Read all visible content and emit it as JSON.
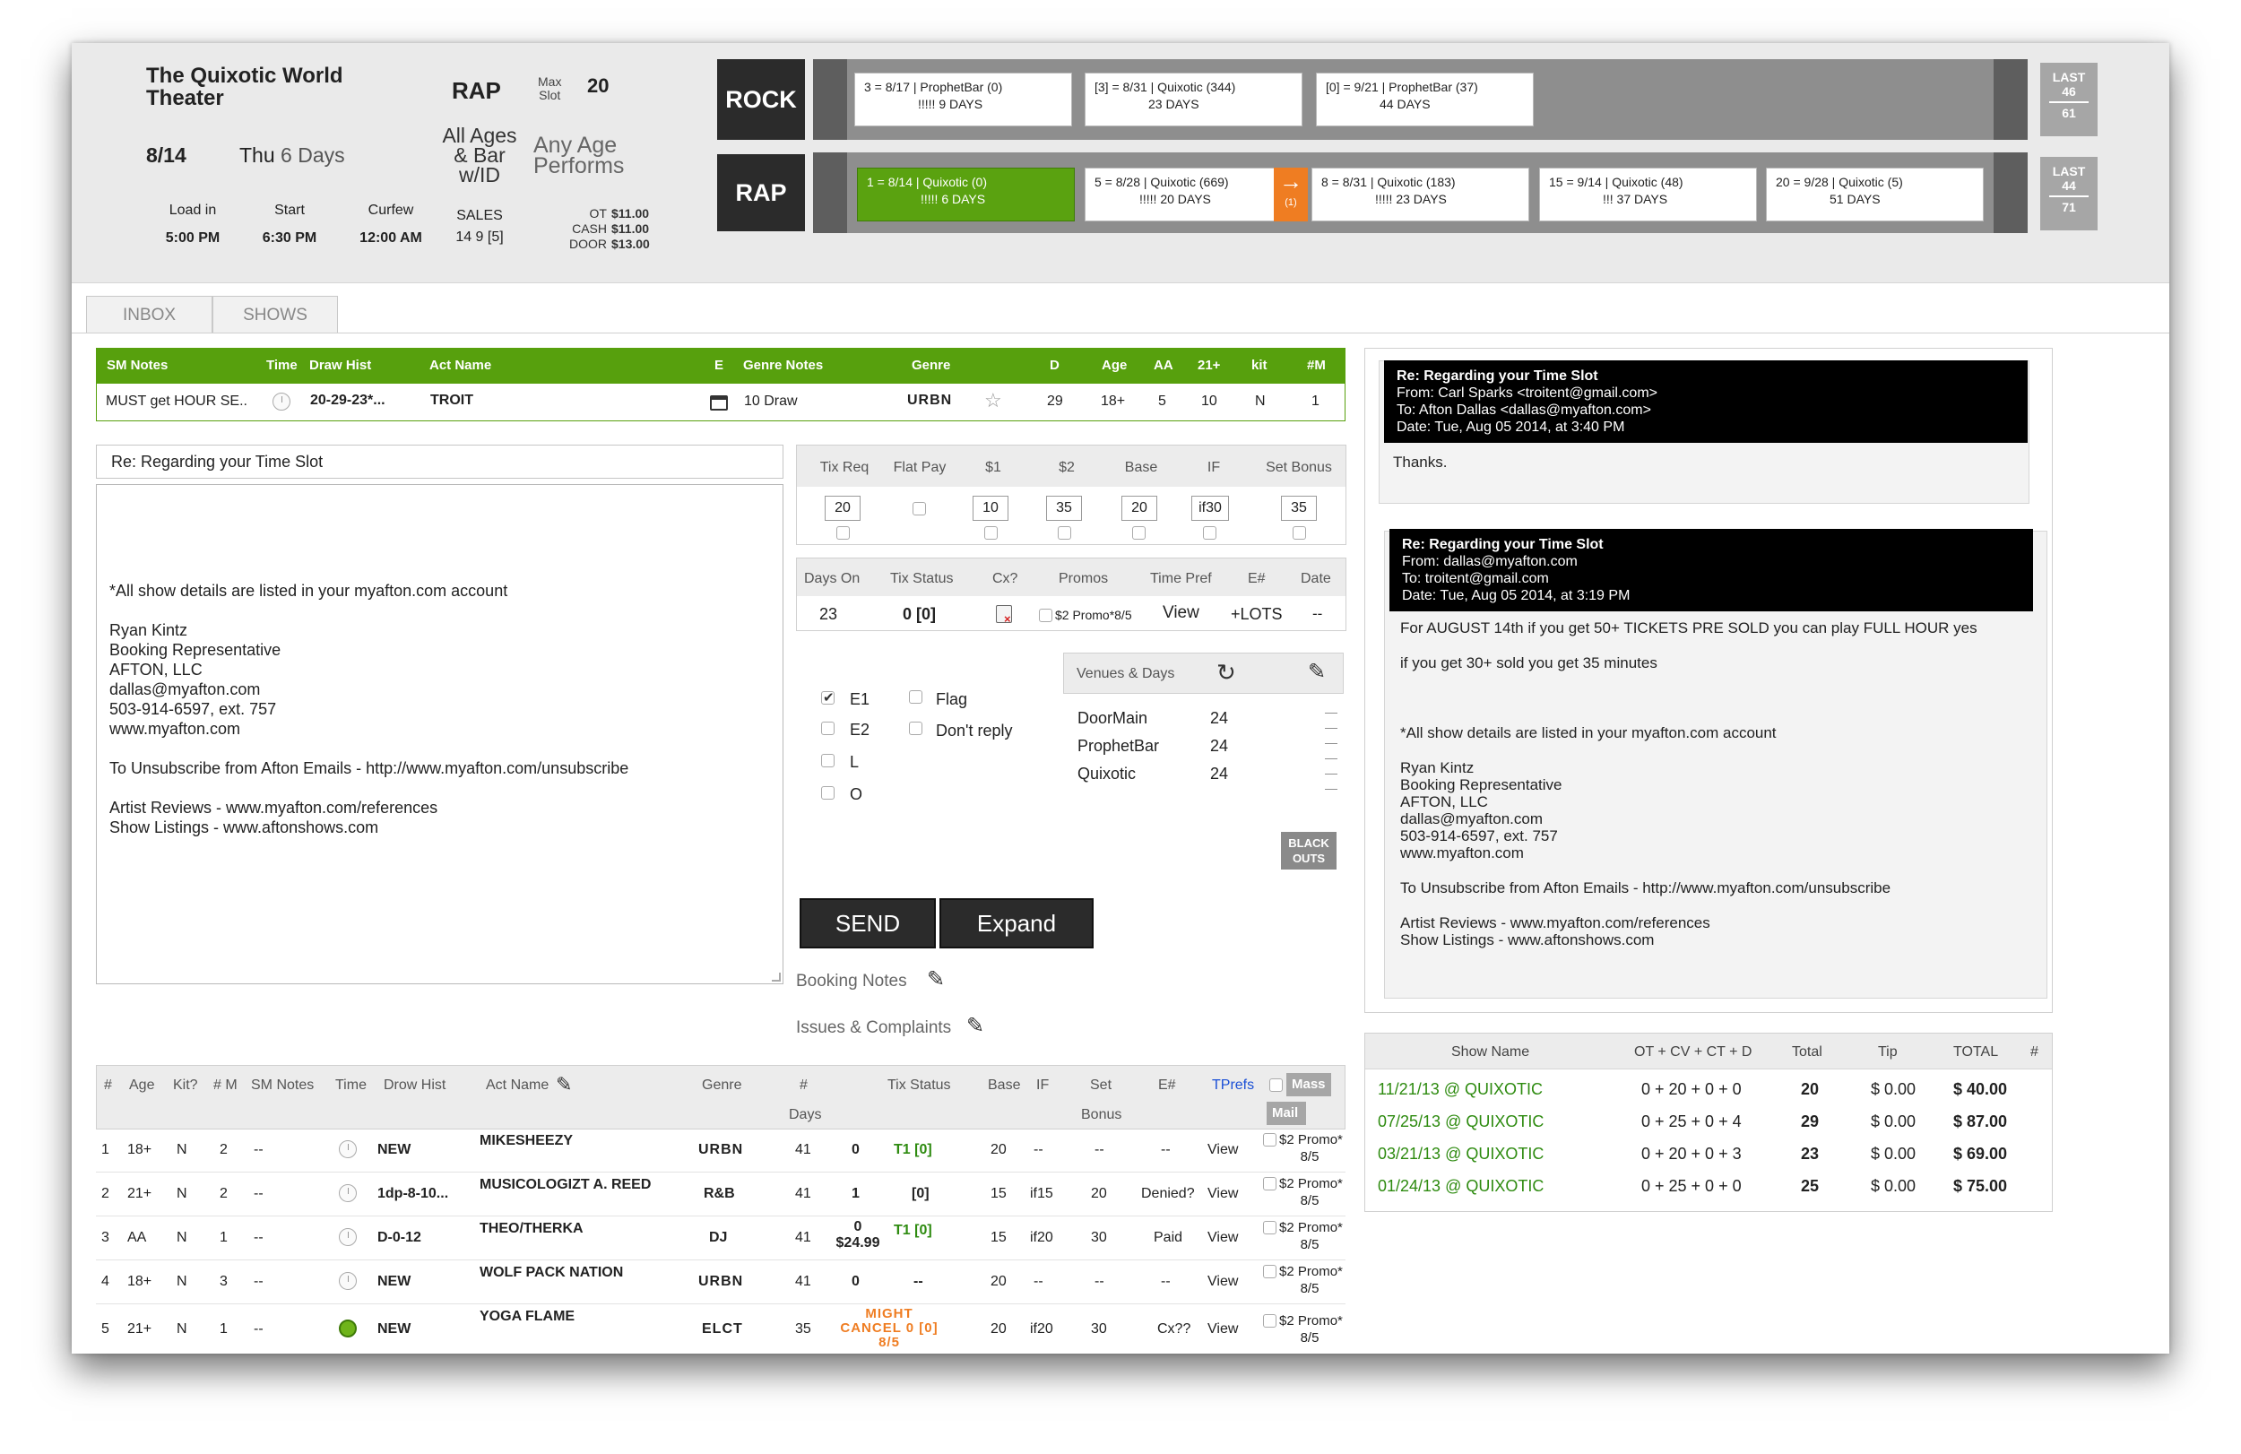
{
  "venue": {
    "name_line1": "The Quixotic World",
    "name_line2": "Theater",
    "date": "8/14",
    "day": "Thu",
    "days_until": "6 Days",
    "genre": "RAP",
    "max_slot_label1": "Max",
    "max_slot_label2": "Slot",
    "max_slot_value": "20",
    "ages_line1": "All Ages",
    "ages_line2": "& Bar",
    "ages_line3": "w/ID",
    "performs_line1": "Any Age",
    "performs_line2": "Performs",
    "load_in_label": "Load in",
    "load_in": "5:00 PM",
    "start_label": "Start",
    "start": "6:30 PM",
    "curfew_label": "Curfew",
    "curfew": "12:00 AM",
    "sales_label": "SALES",
    "sales_value": "14 9 [5]",
    "ot_label": "OT",
    "ot_price": "$11.00",
    "cash_label": "CASH",
    "cash_price": "$11.00",
    "door_label": "DOOR",
    "door_price": "$13.00"
  },
  "timeline": {
    "rock": {
      "label": "ROCK",
      "cards": [
        {
          "line1": "3  =  8/17  |  ProphetBar (0)",
          "line2": "!!!!!  9 DAYS"
        },
        {
          "line1": "[3]  =  8/31  |  Quixotic (344)",
          "line2": "23 DAYS"
        },
        {
          "line1": "[0]  =  9/21  |  ProphetBar (37)",
          "line2": "44 DAYS"
        }
      ],
      "last_label": "LAST",
      "last_top": "46",
      "last_bottom": "61"
    },
    "rap": {
      "label": "RAP",
      "cards": [
        {
          "line1": "1  =  8/14  |  Quixotic (0)",
          "line2": "!!!!!  6 DAYS"
        },
        {
          "line1": "5  =  8/28  |  Quixotic (669)",
          "line2": "!!!!!  20 DAYS"
        },
        {
          "line1": "8  =  8/31  |  Quixotic (183)",
          "line2": "!!!!!  23 DAYS"
        },
        {
          "line1": "15  =  9/14  |  Quixotic (48)",
          "line2": "!!!  37 DAYS"
        },
        {
          "line1": "20  =  9/28  |  Quixotic (5)",
          "line2": "51 DAYS"
        }
      ],
      "arrow_count": "(1)",
      "last_label": "LAST",
      "last_top": "44",
      "last_bottom": "71"
    }
  },
  "tabs": {
    "inbox": "INBOX",
    "shows": "SHOWS"
  },
  "act_table": {
    "headers": [
      "SM Notes",
      "Time",
      "Draw Hist",
      "Act Name",
      "E",
      "Genre Notes",
      "Genre",
      "D",
      "Age",
      "AA",
      "21+",
      "kit",
      "#M"
    ],
    "row": {
      "sm_notes": "MUST get HOUR SE..",
      "draw_hist": "20-29-23*...",
      "act_name": "TROIT",
      "genre_notes": "10 Draw",
      "genre": "URBN",
      "d": "29",
      "age": "18+",
      "aa": "5",
      "plus21": "10",
      "kit": "N",
      "m": "1"
    }
  },
  "compose": {
    "subject": "Re: Regarding your Time Slot",
    "body_lines": [
      "*All show details are listed in your myafton.com account",
      "",
      "Ryan Kintz",
      "Booking Representative",
      "AFTON, LLC",
      "dallas@myafton.com",
      "503-914-6597, ext. 757",
      "www.myafton.com",
      "",
      "To Unsubscribe from Afton Emails - http://www.myafton.com/unsubscribe",
      "",
      "Artist Reviews - www.myafton.com/references",
      "Show Listings - www.aftonshows.com"
    ]
  },
  "pricing": {
    "headers": [
      "Tix Req",
      "Flat Pay",
      "$1",
      "$2",
      "Base",
      "IF",
      "Set Bonus"
    ],
    "tix_req": "20",
    "p1": "10",
    "p2": "35",
    "base": "20",
    "if_val": "if30",
    "set_bonus": "35"
  },
  "status": {
    "headers": [
      "Days On",
      "Tix Status",
      "Cx?",
      "Promos",
      "Time Pref",
      "E#",
      "Date"
    ],
    "days_on": "23",
    "tix_status": "0 [0]",
    "promo": "$2 Promo*8/5",
    "time_pref": "View",
    "e_num": "+LOTS",
    "date": "--"
  },
  "flags": {
    "e1": "E1",
    "e2": "E2",
    "l": "L",
    "o": "O",
    "flag": "Flag",
    "dont_reply": "Don't reply"
  },
  "venues_days": {
    "title": "Venues & Days",
    "items": [
      {
        "name": "DoorMain",
        "days": "24"
      },
      {
        "name": "ProphetBar",
        "days": "24"
      },
      {
        "name": "Quixotic",
        "days": "24"
      }
    ],
    "blackouts_line1": "BLACK",
    "blackouts_line2": "OUTS"
  },
  "actions": {
    "send": "SEND",
    "expand": "Expand",
    "booking_notes": "Booking Notes",
    "issues": "Issues & Complaints"
  },
  "shows_table": {
    "headers": {
      "num": "#",
      "age": "Age",
      "kit": "Kit?",
      "m": "# M",
      "sm_notes": "SM Notes",
      "time": "Time",
      "draw_hist": "Drow Hist",
      "act_name": "Act Name",
      "genre": "Genre",
      "days_num": "#",
      "days": "Days",
      "tix_status": "Tix Status",
      "base": "Base",
      "if_col": "IF",
      "set": "Set",
      "bonus": "Bonus",
      "e_num": "E#",
      "tprefs": "TPrefs",
      "mass": "Mass",
      "mail": "Mail"
    },
    "rows": [
      {
        "num": "1",
        "age": "18+",
        "kit": "N",
        "m": "2",
        "sm": "--",
        "draw": "NEW",
        "act": "MIKESHEEZY",
        "genre": "URBN",
        "days": "41",
        "tix": "0",
        "t1": "T1 [0]",
        "base": "20",
        "ifv": "--",
        "set": "--",
        "e": "--",
        "tpref": "View",
        "promo1": "$2 Promo*",
        "promo2": "8/5"
      },
      {
        "num": "2",
        "age": "21+",
        "kit": "N",
        "m": "2",
        "sm": "--",
        "draw": "1dp-8-10...",
        "act": "MUSICOLOGIZT A. REED",
        "genre": "R&B",
        "days": "41",
        "tix": "1",
        "t1": "[0]",
        "base": "15",
        "ifv": "if15",
        "set": "20",
        "e": "Denied?",
        "tpref": "View",
        "promo1": "$2 Promo*",
        "promo2": "8/5"
      },
      {
        "num": "3",
        "age": "AA",
        "kit": "N",
        "m": "1",
        "sm": "--",
        "draw": "D-0-12",
        "act": "THEO/THERKA",
        "genre": "DJ",
        "days": "41",
        "tix": "0",
        "tix2": "$24.99",
        "t1": "T1 [0]",
        "base": "15",
        "ifv": "if20",
        "set": "30",
        "e": "Paid",
        "tpref": "View",
        "promo1": "$2 Promo*",
        "promo2": "8/5"
      },
      {
        "num": "4",
        "age": "18+",
        "kit": "N",
        "m": "3",
        "sm": "--",
        "draw": "NEW",
        "act": "WOLF PACK NATION",
        "genre": "URBN",
        "days": "41",
        "tix": "0",
        "t1": "--",
        "base": "20",
        "ifv": "--",
        "set": "--",
        "e": "--",
        "tpref": "View",
        "promo1": "$2 Promo*",
        "promo2": "8/5"
      },
      {
        "num": "5",
        "age": "21+",
        "kit": "N",
        "m": "1",
        "sm": "--",
        "draw": "NEW",
        "act": "YOGA FLAME",
        "genre": "ELCT",
        "days": "35",
        "tix": "MIGHT",
        "tix2": "CANCEL 0 [0]",
        "tix3": "8/5",
        "base": "20",
        "ifv": "if20",
        "set": "30",
        "e": "Cx??",
        "tpref": "View",
        "promo1": "$2 Promo*",
        "promo2": "8/5"
      }
    ]
  },
  "messages": [
    {
      "subject": "Re: Regarding your Time Slot",
      "from": "From: Carl Sparks <troitent@gmail.com>",
      "to": "To: Afton Dallas <dallas@myafton.com>",
      "date": "Date: Tue, Aug 05 2014, at 3:40 PM",
      "body": "Thanks."
    },
    {
      "subject": "Re: Regarding your Time Slot",
      "from": "From: dallas@myafton.com",
      "to": "To: troitent@gmail.com",
      "date": "Date: Tue, Aug 05 2014, at 3:19 PM",
      "body_lines": [
        "For AUGUST 14th if you get 50+ TICKETS PRE SOLD you can play FULL HOUR yes",
        "if you get 30+ sold you get 35 minutes",
        "*All show details are listed in your myafton.com account",
        "Ryan Kintz",
        "Booking Representative",
        "AFTON, LLC",
        "dallas@myafton.com",
        "503-914-6597, ext. 757",
        "www.myafton.com",
        "To Unsubscribe from Afton Emails - http://www.myafton.com/unsubscribe",
        "Artist Reviews - www.myafton.com/references",
        "Show Listings - www.aftonshows.com"
      ]
    }
  ],
  "history": {
    "headers": [
      "Show Name",
      "OT + CV + CT + D",
      "Total",
      "Tip",
      "TOTAL",
      "#"
    ],
    "rows": [
      {
        "show": "11/21/13 @ QUIXOTIC",
        "calc": "0 + 20 + 0 + 0",
        "total": "20",
        "tip": "$ 0.00",
        "grand": "$ 40.00"
      },
      {
        "show": "07/25/13 @ QUIXOTIC",
        "calc": "0 + 25 + 0 + 4",
        "total": "29",
        "tip": "$ 0.00",
        "grand": "$ 87.00"
      },
      {
        "show": "03/21/13 @ QUIXOTIC",
        "calc": "0 + 20 + 0 + 3",
        "total": "23",
        "tip": "$ 0.00",
        "grand": "$ 69.00"
      },
      {
        "show": "01/24/13 @ QUIXOTIC",
        "calc": "0 + 25 + 0 + 0",
        "total": "25",
        "tip": "$ 0.00",
        "grand": "$ 75.00"
      }
    ]
  },
  "colors": {
    "green": "#57a00d",
    "orange": "#ef7d22",
    "dark": "#2b2b2b",
    "link_blue": "#1a4fd6",
    "history_green": "#2e8b10"
  }
}
